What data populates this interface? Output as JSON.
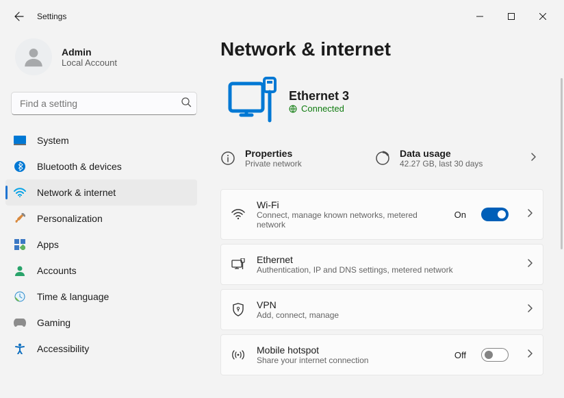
{
  "window": {
    "title": "Settings"
  },
  "profile": {
    "name": "Admin",
    "sub": "Local Account"
  },
  "search": {
    "placeholder": "Find a setting"
  },
  "nav": {
    "items": [
      "System",
      "Bluetooth & devices",
      "Network & internet",
      "Personalization",
      "Apps",
      "Accounts",
      "Time & language",
      "Gaming",
      "Accessibility"
    ],
    "selected_index": 2
  },
  "page": {
    "heading": "Network & internet",
    "hero": {
      "title": "Ethernet 3",
      "status": "Connected"
    },
    "properties": {
      "title": "Properties",
      "sub": "Private network"
    },
    "usage": {
      "title": "Data usage",
      "sub": "42.27 GB, last 30 days"
    },
    "cards": {
      "wifi": {
        "title": "Wi-Fi",
        "sub": "Connect, manage known networks, metered network",
        "state": "On"
      },
      "ethernet": {
        "title": "Ethernet",
        "sub": "Authentication, IP and DNS settings, metered network"
      },
      "vpn": {
        "title": "VPN",
        "sub": "Add, connect, manage"
      },
      "hotspot": {
        "title": "Mobile hotspot",
        "sub": "Share your internet connection",
        "state": "Off"
      }
    }
  }
}
